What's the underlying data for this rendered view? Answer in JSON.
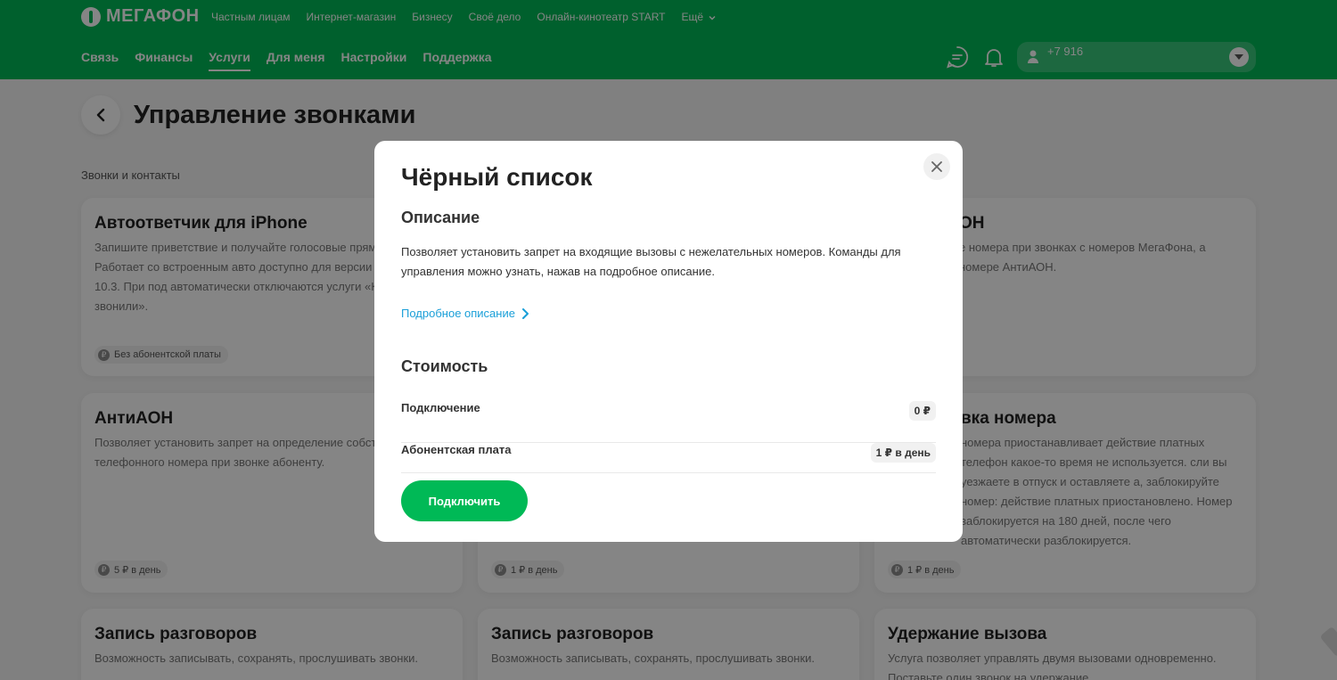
{
  "header": {
    "logo": "МЕГАФОН",
    "top_links": [
      "Частным лицам",
      "Интернет-магазин",
      "Бизнесу",
      "Своё дело",
      "Онлайн-кинотеатр START",
      "Ещё"
    ],
    "main_nav": [
      "Связь",
      "Финансы",
      "Услуги",
      "Для меня",
      "Настройки",
      "Поддержка"
    ],
    "active_nav": "Услуги",
    "account_phone": "+7 916"
  },
  "page": {
    "title": "Управление звонками",
    "section": "Звонки и контакты"
  },
  "cards": [
    {
      "title": "Автоответчик для iPhone",
      "desc": "Запишите приветствие и получайте голосовые прямо на iPhone. Работает со встроенным авто доступно для версии iOS не ниже 10.3. При под автоматически отключаются услуги «Кто звонил звонили».",
      "price": "Без абонентской платы"
    },
    {
      "title": "ОН",
      "desc": "е номера при звонках с номеров МегаФона, а номере АнтиАОН.",
      "price": ""
    },
    {
      "title": "АнтиАОН",
      "desc": "Позволяет установить запрет на определение собственного телефонного номера при звонке абоненту.",
      "price": "5 ₽ в день"
    },
    {
      "title": "",
      "desc": "",
      "price": "1 ₽ в день"
    },
    {
      "title": "вка номера",
      "desc": "номера приостанавливает действие платных телефон какое-то время не используется. сли вы уезжаете в отпуск и оставляете а, заблокируйте номер: действие платных приостановлено. Номер заблокируется на 180 дней, после чего автоматически разблокируется.",
      "price": "1 ₽ в день"
    },
    {
      "title": "Запись разговоров",
      "desc": "Возможность записывать, сохранять, прослушивать звонки.",
      "price": ""
    },
    {
      "title": "Запись разговоров",
      "desc": "Возможность записывать, сохранять, прослушивать звонки.",
      "price": ""
    },
    {
      "title": "Удержание вызова",
      "desc": "Услуга позволяет управлять двумя вызовами одновременно. Поставьте один звонок на удержание",
      "price": ""
    }
  ],
  "modal": {
    "title": "Чёрный список",
    "description_heading": "Описание",
    "description": "Позволяет установить запрет на входящие вызовы с нежелательных номеров. Команды для управления можно узнать, нажав на подробное описание.",
    "more_link": "Подробное описание",
    "cost_heading": "Стоимость",
    "prices": [
      {
        "label": "Подключение",
        "value": "0 ₽"
      },
      {
        "label": "Абонентская плата",
        "value": "1 ₽ в день"
      }
    ],
    "connect_label": "Подключить"
  },
  "colors": {
    "brand_green": "#00b956",
    "link_blue": "#1a9fd8"
  }
}
